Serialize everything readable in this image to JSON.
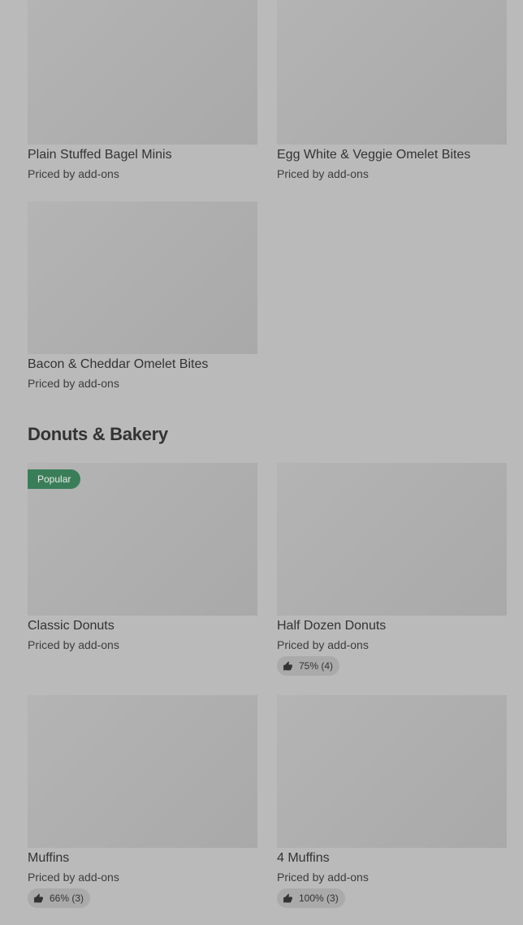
{
  "items_top": [
    {
      "title": "Plain Stuffed Bagel Minis",
      "subtitle": "Priced by add-ons"
    },
    {
      "title": "Egg White & Veggie Omelet Bites",
      "subtitle": "Priced by add-ons"
    },
    {
      "title": "Bacon & Cheddar Omelet Bites",
      "subtitle": "Priced by add-ons"
    }
  ],
  "section": {
    "title": "Donuts & Bakery",
    "items": [
      {
        "title": "Classic Donuts",
        "subtitle": "Priced by add-ons",
        "badge": "Popular"
      },
      {
        "title": "Half Dozen Donuts",
        "subtitle": "Priced by add-ons",
        "rating": "75% (4)"
      },
      {
        "title": "Muffins",
        "subtitle": "Priced by add-ons",
        "rating": "66% (3)"
      },
      {
        "title": "4 Muffins",
        "subtitle": "Priced by add-ons",
        "rating": "100% (3)"
      }
    ]
  },
  "icons": {
    "rating": "thumbs-up-icon"
  },
  "colors": {
    "badge_bg": "#3a7e59",
    "background": "#bababa"
  }
}
